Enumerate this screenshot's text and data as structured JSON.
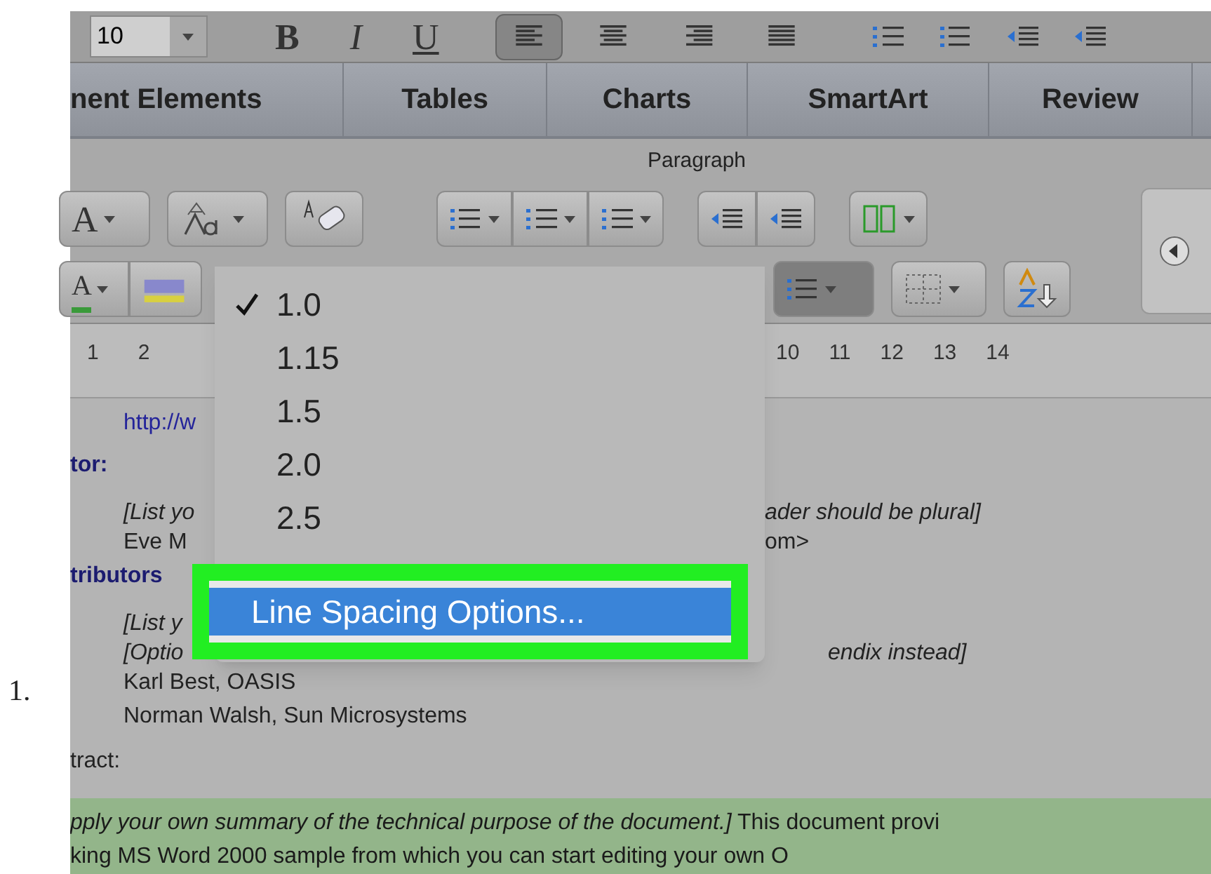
{
  "list_marker": "1.",
  "toolbar": {
    "font_size": "10",
    "format_buttons": [
      "B",
      "I",
      "U"
    ],
    "align_buttons": [
      {
        "kind": "left",
        "selected": true
      },
      {
        "kind": "center",
        "selected": false
      },
      {
        "kind": "right",
        "selected": false
      },
      {
        "kind": "justify",
        "selected": false
      }
    ]
  },
  "tabs": [
    {
      "label": "nent Elements",
      "selected": false
    },
    {
      "label": "Tables",
      "selected": false
    },
    {
      "label": "Charts",
      "selected": false
    },
    {
      "label": "SmartArt",
      "selected": false
    },
    {
      "label": "Review",
      "selected": false
    }
  ],
  "ribbon": {
    "group_label": "Paragraph",
    "font_color_button": "A",
    "text_color_button": "A"
  },
  "ruler": {
    "left_marks": [
      "1",
      "2"
    ],
    "right_marks": [
      "10",
      "11",
      "12",
      "13",
      "14"
    ]
  },
  "line_spacing_menu": [
    {
      "label": "1.0",
      "checked": true,
      "selected": false
    },
    {
      "label": "1.15",
      "checked": false,
      "selected": false
    },
    {
      "label": "1.5",
      "checked": false,
      "selected": false
    },
    {
      "label": "2.0",
      "checked": false,
      "selected": false
    },
    {
      "label": "2.5",
      "checked": false,
      "selected": false
    },
    {
      "label": "Line Spacing Options...",
      "checked": false,
      "selected": true
    }
  ],
  "document": [
    {
      "kind": "link",
      "left": "http://w"
    },
    {
      "kind": "heading",
      "left": "tor:"
    },
    {
      "kind": "note",
      "left": "[List yo",
      "right": "ader should be plural]"
    },
    {
      "kind": "body",
      "left": "Eve M",
      "right": "om>"
    },
    {
      "kind": "heading",
      "left": "tributors"
    },
    {
      "kind": "note",
      "left": "[List y"
    },
    {
      "kind": "note",
      "left": "[Optio",
      "right": "endix instead]"
    },
    {
      "kind": "body",
      "left": "Karl Best, OASIS"
    },
    {
      "kind": "body",
      "left": "Norman Walsh, Sun Microsystems"
    },
    {
      "kind": "plain",
      "left": "tract:"
    }
  ],
  "abstract": [
    "*pply your own summary of the technical purpose of the document.]* This document provi",
    "king MS Word 2000 sample from which you can start editing your own O"
  ]
}
